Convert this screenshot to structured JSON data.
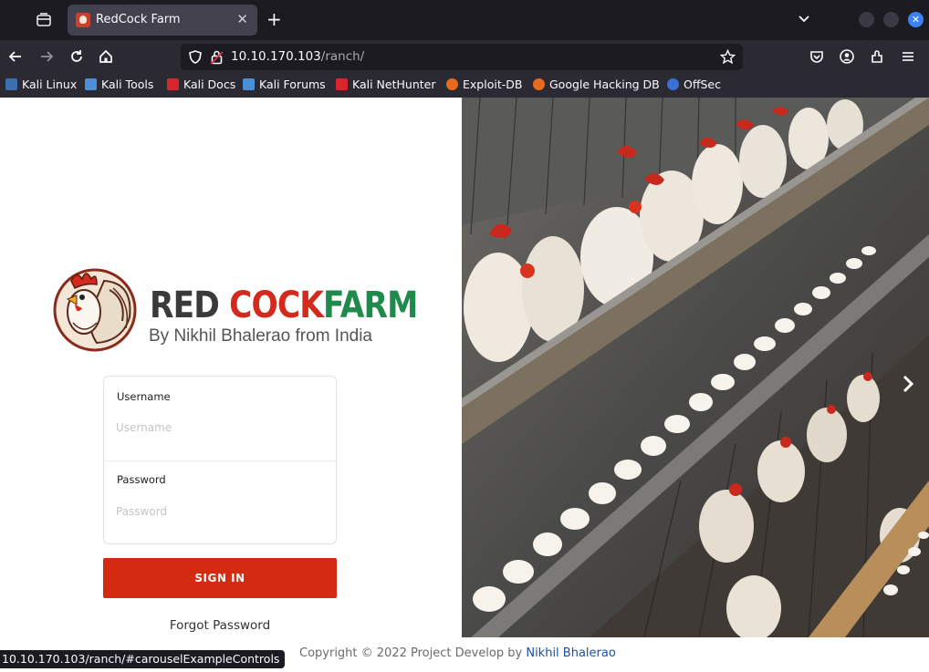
{
  "browser": {
    "tab_title": "RedCock Farm",
    "tab_close": "✕",
    "new_tab": "+",
    "url_host": "10.10.170.103",
    "url_path": "/ranch/",
    "status_url": "10.10.170.103/ranch/#carouselExampleControls"
  },
  "bookmarks": [
    {
      "label": "Kali Linux",
      "color": "#3a6fb0"
    },
    {
      "label": "Kali Tools",
      "color": "#4b8fd6"
    },
    {
      "label": "Kali Docs",
      "color": "#d8262c"
    },
    {
      "label": "Kali Forums",
      "color": "#4b8fd6"
    },
    {
      "label": "Kali NetHunter",
      "color": "#d8262c"
    },
    {
      "label": "Exploit-DB",
      "color": "#e86a1c"
    },
    {
      "label": "Google Hacking DB",
      "color": "#e86a1c"
    },
    {
      "label": "OffSec",
      "color": "#3a6fd8"
    }
  ],
  "logo": {
    "word_red": "RED ",
    "word_cock": "COCK",
    "word_farm": "FARM",
    "subtitle": "By Nikhil Bhalerao from India"
  },
  "form": {
    "username_label": "Username",
    "username_placeholder": "Username",
    "password_label": "Password",
    "password_placeholder": "Password",
    "signin_label": "SIGN IN",
    "forgot_label": "Forgot Password"
  },
  "footer": {
    "copyright_text": "Copyright © 2022 Project Develop by ",
    "author_link": "Nikhil Bhalerao"
  }
}
